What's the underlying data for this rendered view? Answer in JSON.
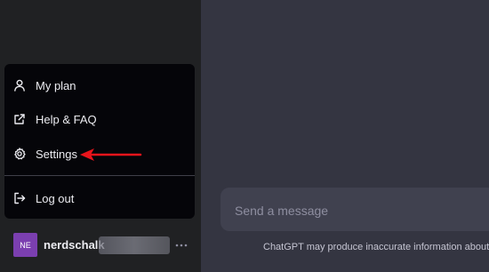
{
  "menu": {
    "items": [
      {
        "label": "My plan",
        "icon": "user-icon"
      },
      {
        "label": "Help & FAQ",
        "icon": "external-link-icon"
      },
      {
        "label": "Settings",
        "icon": "gear-icon"
      },
      {
        "label": "Log out",
        "icon": "logout-icon"
      }
    ]
  },
  "annotation": {
    "color": "#e8141b",
    "icon": "red-arrow-icon"
  },
  "user": {
    "initials": "NE",
    "name": "nerdschalk",
    "avatar_color": "#7b3fb0"
  },
  "composer": {
    "placeholder": "Send a message"
  },
  "footer": {
    "disclaimer": "ChatGPT may produce inaccurate information about pe"
  }
}
